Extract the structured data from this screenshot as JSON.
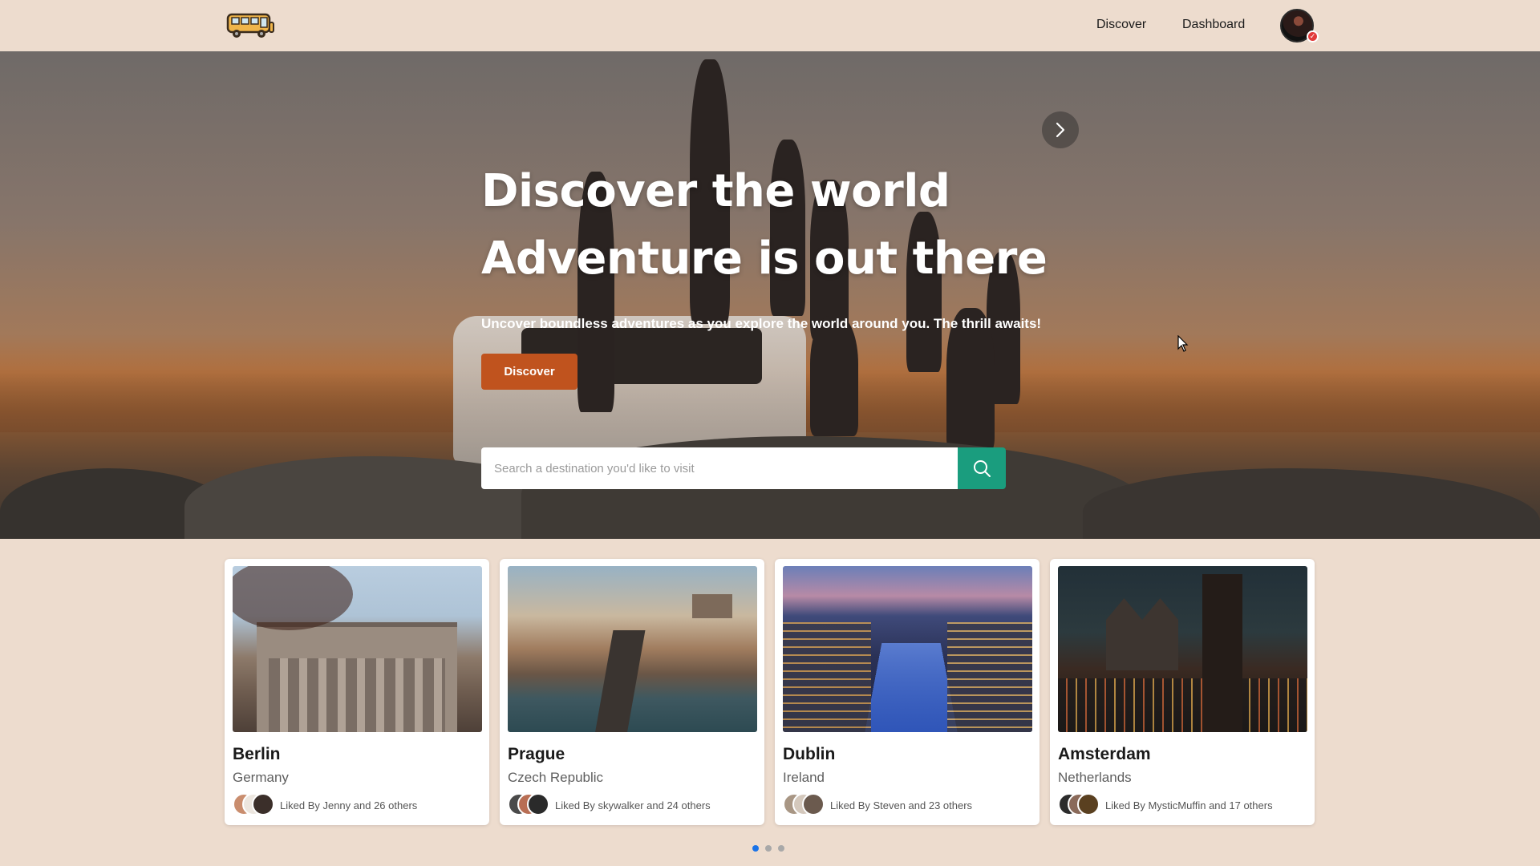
{
  "nav": {
    "logo_icon": "bus-icon",
    "links": [
      "Discover",
      "Dashboard"
    ],
    "avatar_badge": "✓"
  },
  "hero": {
    "title_line1": "Discover the world",
    "title_line2": "Adventure is out there",
    "subtitle": "Uncover boundless adventures as you explore the world around you. The thrill awaits!",
    "button_label": "Discover",
    "search_placeholder": "Search a destination you'd like to visit",
    "search_icon": "search-icon",
    "primary_color": "#c0531e",
    "search_color": "#1a9d7e"
  },
  "destinations": [
    {
      "city": "Berlin",
      "country": "Germany",
      "liked_by": "Liked By Jenny and 26 others"
    },
    {
      "city": "Prague",
      "country": "Czech Republic",
      "liked_by": "Liked By skywalker and 24 others"
    },
    {
      "city": "Dublin",
      "country": "Ireland",
      "liked_by": "Liked By Steven and 23 others"
    },
    {
      "city": "Amsterdam",
      "country": "Netherlands",
      "liked_by": "Liked By MysticMuffin and 17 others"
    }
  ],
  "carousel": {
    "pages": 3,
    "active_page": 1
  }
}
